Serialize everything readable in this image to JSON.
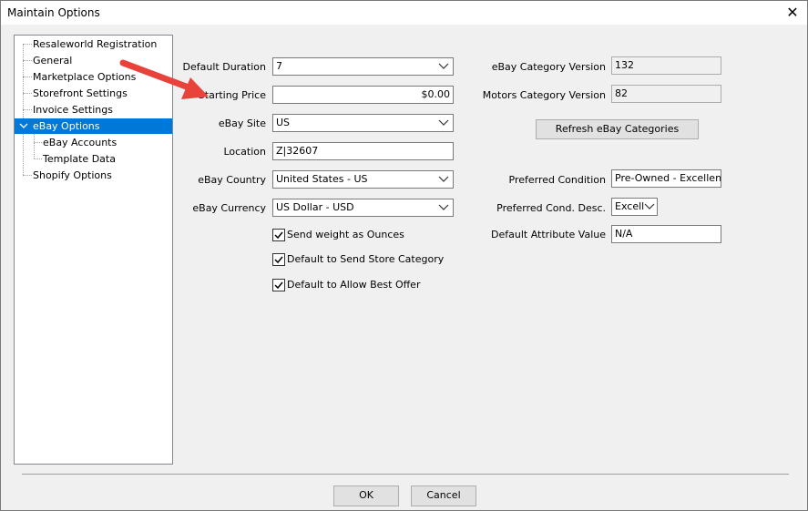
{
  "window": {
    "title": "Maintain Options",
    "close_glyph": "✕"
  },
  "tree": {
    "items": [
      {
        "label": "Resaleworld Registration"
      },
      {
        "label": "General"
      },
      {
        "label": "Marketplace Options"
      },
      {
        "label": "Storefront Settings"
      },
      {
        "label": "Invoice Settings"
      },
      {
        "label": "eBay Options",
        "selected": true,
        "expanded": true
      },
      {
        "label": "eBay Accounts"
      },
      {
        "label": "Template Data"
      },
      {
        "label": "Shopify Options"
      }
    ]
  },
  "form": {
    "default_duration": {
      "label": "Default Duration",
      "value": "7"
    },
    "starting_price": {
      "label": "Starting Price",
      "value": "$0.00"
    },
    "ebay_site": {
      "label": "eBay Site",
      "value": "US"
    },
    "location": {
      "label": "Location",
      "value": "Z|32607"
    },
    "ebay_country": {
      "label": "eBay Country",
      "value": "United States - US"
    },
    "ebay_currency": {
      "label": "eBay Currency",
      "value": "US Dollar - USD"
    },
    "checkboxes": [
      {
        "label": "Send weight as Ounces",
        "checked": true
      },
      {
        "label": "Default to Send Store Category",
        "checked": true
      },
      {
        "label": "Default to Allow Best Offer",
        "checked": true
      }
    ],
    "ebay_category_version": {
      "label": "eBay Category Version",
      "value": "132"
    },
    "motors_category_version": {
      "label": "Motors Category Version",
      "value": "82"
    },
    "refresh_button": "Refresh eBay Categories",
    "preferred_condition": {
      "label": "Preferred Condition",
      "value": "Pre-Owned - Excellent|N"
    },
    "preferred_cond_desc": {
      "label": "Preferred Cond. Desc.",
      "value": "Excelle"
    },
    "default_attribute_value": {
      "label": "Default Attribute Value",
      "value": "N/A"
    }
  },
  "buttons": {
    "ok": "OK",
    "cancel": "Cancel"
  },
  "icons": {
    "annotation": "red-arrow-icon",
    "dropdown": "chevron-down-icon",
    "check": "checkmark-icon"
  },
  "colors": {
    "selection": "#0078d7",
    "arrow": "#e8423b"
  }
}
